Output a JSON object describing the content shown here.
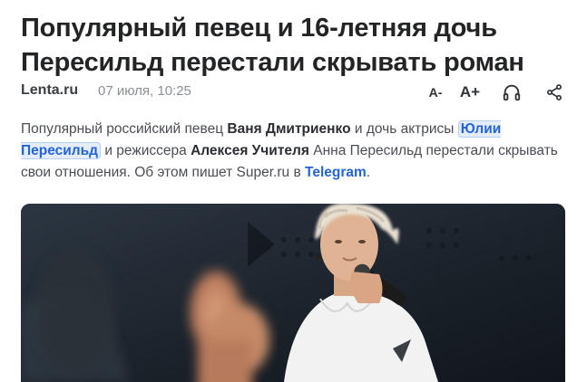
{
  "article": {
    "title_line1": "Популярный певец и 16-летняя дочь",
    "title_line2": "Пересильд перестали скрывать роман",
    "source": "Lenta.ru",
    "date": "07 июля, 10:25",
    "lead": {
      "p1": "Популярный российский певец ",
      "b1": "Ваня Дмитриенко",
      "p2": " и дочь актрисы ",
      "hl": "Юлии Пересильд",
      "p3": " и режиссера ",
      "b2": "Алексея Учителя",
      "p4": " Анна Пересильд перестали скрывать свои отношения. Об этом пишет Super.ru в ",
      "link": "Telegram",
      "p5": "."
    }
  },
  "toolbar": {
    "font_decrease": "A-",
    "font_increase": "A+",
    "listen_icon": "headphones-icon",
    "share_icon": "share-icon"
  },
  "photo": {
    "description_icon": "singer-photo"
  }
}
